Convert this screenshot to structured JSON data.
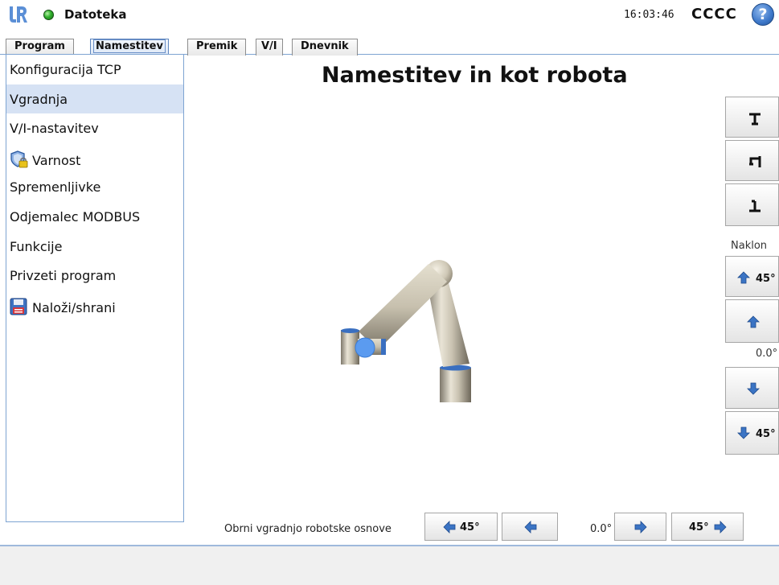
{
  "header": {
    "file_menu": "Datoteka",
    "time": "16:03:46",
    "robot_name": "CCCC",
    "help_symbol": "?"
  },
  "tabs": [
    {
      "label": "Program"
    },
    {
      "label": "Namestitev",
      "active": true
    },
    {
      "label": "Premik"
    },
    {
      "label": "V/I"
    },
    {
      "label": "Dnevnik"
    }
  ],
  "sidebar": {
    "items": [
      {
        "label": "Konfiguracija TCP"
      },
      {
        "label": "Vgradnja",
        "selected": true
      },
      {
        "label": "V/I-nastavitev"
      },
      {
        "label": "Varnost",
        "icon": "shield-lock-icon"
      },
      {
        "label": "Spremenljivke"
      },
      {
        "label": "Odjemalec MODBUS"
      },
      {
        "label": "Funkcije"
      },
      {
        "label": "Privzeti program"
      },
      {
        "label": "Naloži/shrani",
        "icon": "floppy-disk-icon"
      }
    ]
  },
  "main": {
    "title": "Namestitev in kot robota"
  },
  "tilt": {
    "label": "Naklon",
    "up_45": "45°",
    "value": "0.0°",
    "down_45": "45°"
  },
  "rotate": {
    "label": "Obrni vgradnjo robotske osnove",
    "left_45": "45°",
    "value": "0.0°",
    "right_45": "45°"
  },
  "colors": {
    "accent": "#7ea4d2",
    "selected": "#d6e2f4",
    "arrow_blue": "#3b74c4",
    "robot_joint": "#3a7bd5"
  }
}
